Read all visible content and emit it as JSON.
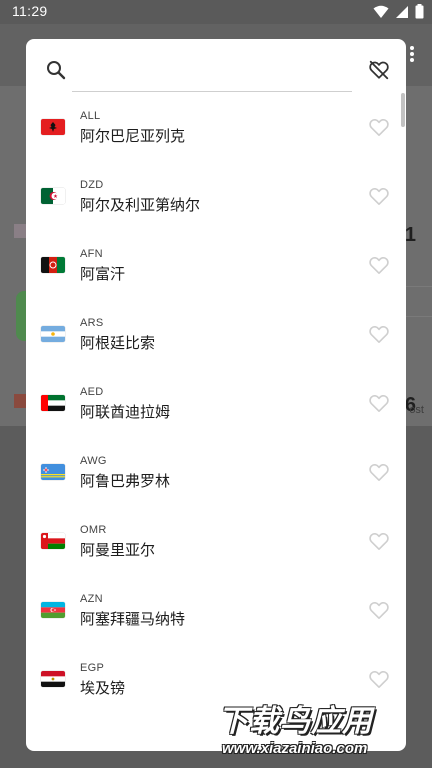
{
  "status_bar": {
    "time": "11:29"
  },
  "background": {
    "value_1": "1",
    "value_2": "6",
    "partial_text": "ost"
  },
  "search": {
    "placeholder": "",
    "value": ""
  },
  "currencies": [
    {
      "code": "ALL",
      "name": "阿尔巴尼亚列克",
      "flag": "albania"
    },
    {
      "code": "DZD",
      "name": "阿尔及利亚第纳尔",
      "flag": "algeria"
    },
    {
      "code": "AFN",
      "name": "阿富汗",
      "flag": "afghanistan"
    },
    {
      "code": "ARS",
      "name": "阿根廷比索",
      "flag": "argentina"
    },
    {
      "code": "AED",
      "name": "阿联酋迪拉姆",
      "flag": "uae"
    },
    {
      "code": "AWG",
      "name": "阿鲁巴弗罗林",
      "flag": "aruba"
    },
    {
      "code": "OMR",
      "name": "阿曼里亚尔",
      "flag": "oman"
    },
    {
      "code": "AZN",
      "name": "阿塞拜疆马纳特",
      "flag": "azerbaijan"
    },
    {
      "code": "EGP",
      "name": "埃及镑",
      "flag": "egypt"
    }
  ],
  "icons": {
    "search": "search-icon",
    "favorites_filter": "heart-off-icon",
    "favorite": "heart-outline-icon"
  },
  "colors": {
    "heart": "#cfcfcf",
    "dialog_bg": "#ffffff",
    "scrim": "#5f5f5f"
  },
  "watermark": {
    "main": "下载鸟应用",
    "sub": "www.xiazainiao.com"
  }
}
